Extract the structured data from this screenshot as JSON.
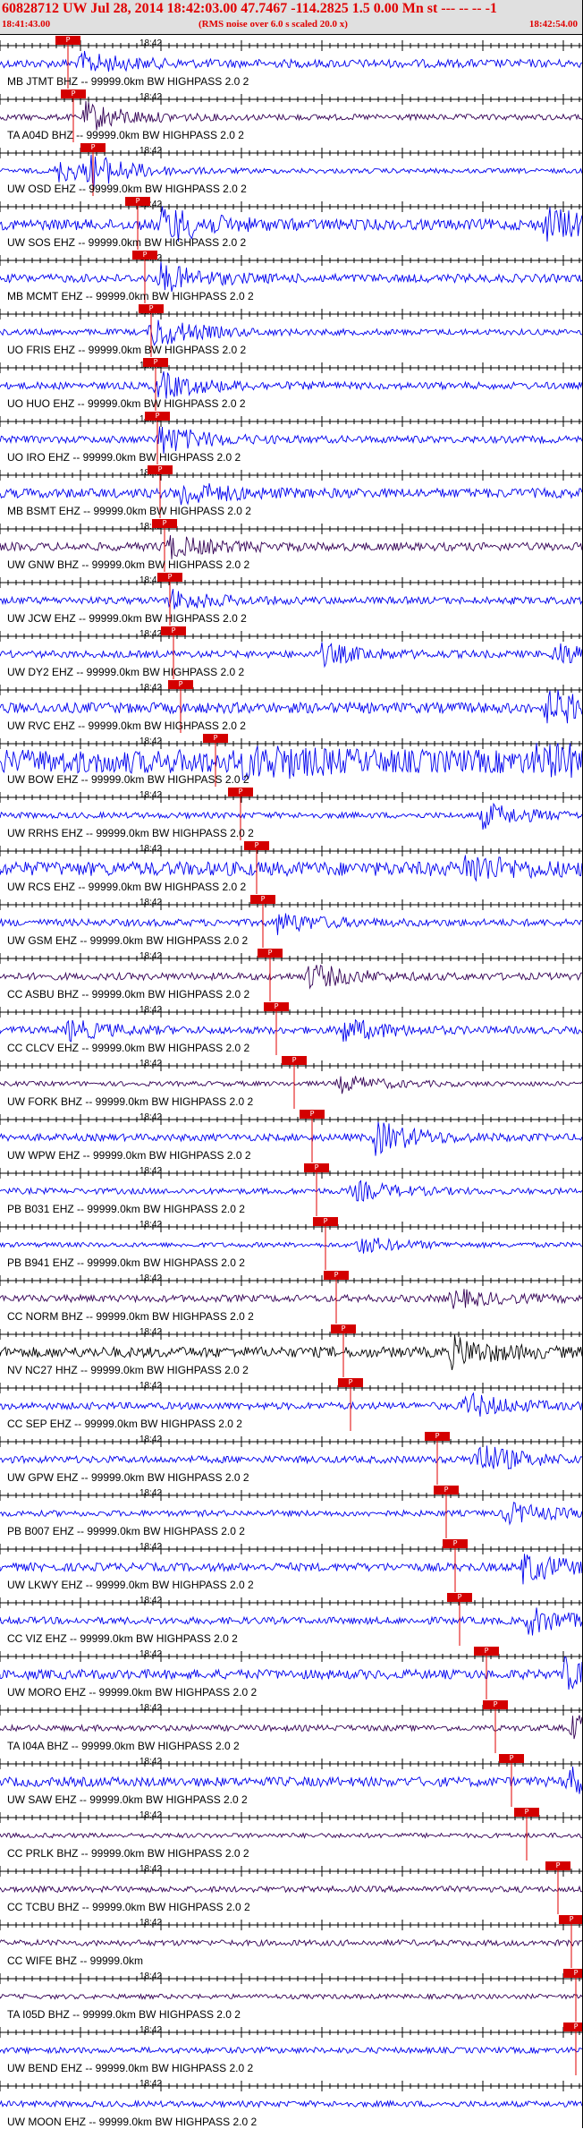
{
  "header": {
    "title": "60828712 UW Jul 28, 2014 18:42:03.00   47.7467 -114.2825  1.5 0.00 Mn st --- -- --  -1",
    "start_time": "18:41:43.00",
    "subtitle": "(RMS noise over 6.0 s scaled 20.0 x)",
    "end_time": "18:42:54.00"
  },
  "minute_label": "18:42",
  "pick_label": "P",
  "colors": {
    "blue": "#0000ee",
    "dark": "#330055",
    "black": "#000000",
    "red": "#e00000"
  },
  "traces": [
    {
      "label": "MB JTMT BHZ -- 99999.0km BW  HIGHPASS  2.0  2",
      "color": "blue",
      "amp": 0.35,
      "bursts": [
        [
          90,
          0.8
        ]
      ]
    },
    {
      "label": "TA A04D BHZ -- 99999.0km BW  HIGHPASS  2.0  2",
      "color": "dark",
      "amp": 0.25,
      "bursts": [
        [
          95,
          1.2
        ]
      ]
    },
    {
      "label": "UW OSD EHZ -- 99999.0km BW  HIGHPASS  2.0  2",
      "color": "blue",
      "amp": 0.2,
      "bursts": [
        [
          65,
          0.9
        ],
        [
          100,
          1.1
        ]
      ]
    },
    {
      "label": "UW SOS EHZ -- 99999.0km BW  HIGHPASS  2.0  2",
      "color": "blue",
      "amp": 0.45,
      "bursts": [
        [
          180,
          1.6
        ],
        [
          610,
          1.4
        ]
      ]
    },
    {
      "label": "MB MCMT EHZ -- 99999.0km BW  HIGHPASS  2.0  2",
      "color": "blue",
      "amp": 0.35,
      "bursts": [
        [
          180,
          1.1
        ]
      ]
    },
    {
      "label": "UO FRIS EHZ -- 99999.0km BW  HIGHPASS  2.0  2",
      "color": "blue",
      "amp": 0.25,
      "bursts": [
        [
          170,
          1.3
        ]
      ]
    },
    {
      "label": "UO HUO EHZ -- 99999.0km BW  HIGHPASS  2.0  2",
      "color": "blue",
      "amp": 0.3,
      "bursts": [
        [
          175,
          1.1
        ]
      ]
    },
    {
      "label": "UO IRO EHZ -- 99999.0km BW  HIGHPASS  2.0  2",
      "color": "blue",
      "amp": 0.3,
      "bursts": [
        [
          178,
          1.2
        ]
      ]
    },
    {
      "label": "MB BSMT EHZ -- 99999.0km BW  HIGHPASS  2.0  2",
      "color": "blue",
      "amp": 0.4,
      "bursts": [
        [
          200,
          1.0
        ]
      ]
    },
    {
      "label": "UW GNW BHZ -- 99999.0km BW  HIGHPASS  2.0  2",
      "color": "dark",
      "amp": 0.35,
      "bursts": [
        [
          185,
          0.9
        ]
      ]
    },
    {
      "label": "UW JCW EHZ -- 99999.0km BW  HIGHPASS  2.0  2",
      "color": "blue",
      "amp": 0.3,
      "bursts": [
        [
          190,
          0.8
        ]
      ]
    },
    {
      "label": "UW DY2 EHZ -- 99999.0km BW  HIGHPASS  2.0  2",
      "color": "blue",
      "amp": 0.3,
      "bursts": [
        [
          360,
          0.8
        ],
        [
          620,
          0.9
        ]
      ]
    },
    {
      "label": "UW RVC EHZ -- 99999.0km BW  HIGHPASS  2.0  2",
      "color": "blue",
      "amp": 0.45,
      "bursts": [
        [
          610,
          1.5
        ]
      ]
    },
    {
      "label": "UW BOW EHZ -- 99999.0km BW  HIGHPASS  2.0  2",
      "color": "blue",
      "amp": 1.0,
      "bursts": [
        [
          270,
          1.6
        ],
        [
          600,
          1.4
        ]
      ]
    },
    {
      "label": "UW RRHS EHZ -- 99999.0km BW  HIGHPASS  2.0  2",
      "color": "blue",
      "amp": 0.25,
      "bursts": [
        [
          540,
          1.0
        ]
      ]
    },
    {
      "label": "UW RCS EHZ -- 99999.0km BW  HIGHPASS  2.0  2",
      "color": "blue",
      "amp": 0.6,
      "bursts": [
        [
          520,
          1.1
        ]
      ]
    },
    {
      "label": "UW GSM EHZ -- 99999.0km BW  HIGHPASS  2.0  2",
      "color": "blue",
      "amp": 0.3,
      "bursts": [
        [
          310,
          0.8
        ]
      ]
    },
    {
      "label": "CC ASBU BHZ -- 99999.0km BW  HIGHPASS  2.0  2",
      "color": "dark",
      "amp": 0.3,
      "bursts": [
        [
          345,
          1.0
        ]
      ]
    },
    {
      "label": "CC CLCV EHZ -- 99999.0km BW  HIGHPASS  2.0  2",
      "color": "blue",
      "amp": 0.3,
      "bursts": [
        [
          75,
          0.8
        ],
        [
          380,
          1.0
        ]
      ]
    },
    {
      "label": "UW FORK BHZ -- 99999.0km BW  HIGHPASS  2.0  2",
      "color": "dark",
      "amp": 0.2,
      "bursts": [
        [
          380,
          0.7
        ]
      ]
    },
    {
      "label": "UW WPW EHZ -- 99999.0km BW  HIGHPASS  2.0  2",
      "color": "blue",
      "amp": 0.3,
      "bursts": [
        [
          420,
          1.3
        ]
      ]
    },
    {
      "label": "PB B031 EHZ -- 99999.0km BW  HIGHPASS  2.0  2",
      "color": "blue",
      "amp": 0.25,
      "bursts": [
        [
          395,
          0.8
        ]
      ]
    },
    {
      "label": "PB B941 EHZ -- 99999.0km BW  HIGHPASS  2.0  2",
      "color": "blue",
      "amp": 0.2,
      "bursts": [
        [
          400,
          0.7
        ]
      ]
    },
    {
      "label": "CC NORM BHZ -- 99999.0km BW  HIGHPASS  2.0  2",
      "color": "dark",
      "amp": 0.3,
      "bursts": [
        [
          505,
          0.7
        ]
      ]
    },
    {
      "label": "NV NC27 HHZ -- 99999.0km BW  HIGHPASS  2.0  2",
      "color": "black",
      "amp": 0.45,
      "bursts": [
        [
          505,
          1.1
        ]
      ]
    },
    {
      "label": "CC SEP EHZ -- 99999.0km BW  HIGHPASS  2.0  2",
      "color": "blue",
      "amp": 0.3,
      "bursts": [
        [
          520,
          1.0
        ]
      ]
    },
    {
      "label": "UW GPW EHZ -- 99999.0km BW  HIGHPASS  2.0  2",
      "color": "blue",
      "amp": 0.3,
      "bursts": [
        [
          530,
          1.4
        ]
      ]
    },
    {
      "label": "PB B007 EHZ -- 99999.0km BW  HIGHPASS  2.0  2",
      "color": "blue",
      "amp": 0.25,
      "bursts": [
        [
          565,
          0.9
        ]
      ]
    },
    {
      "label": "UW LKWY EHZ -- 99999.0km BW  HIGHPASS  2.0  2",
      "color": "blue",
      "amp": 0.35,
      "bursts": [
        [
          585,
          1.2
        ]
      ]
    },
    {
      "label": "CC VIZ EHZ -- 99999.0km BW  HIGHPASS  2.0  2",
      "color": "blue",
      "amp": 0.3,
      "bursts": [
        [
          590,
          1.1
        ]
      ]
    },
    {
      "label": "UW MORO EHZ -- 99999.0km BW  HIGHPASS  2.0  2",
      "color": "blue",
      "amp": 0.4,
      "bursts": [
        [
          630,
          1.2
        ]
      ]
    },
    {
      "label": "TA I04A BHZ -- 99999.0km BW  HIGHPASS  2.0  2",
      "color": "dark",
      "amp": 0.25,
      "bursts": [
        [
          640,
          1.1
        ]
      ]
    },
    {
      "label": "UW SAW EHZ -- 99999.0km BW  HIGHPASS  2.0  2",
      "color": "blue",
      "amp": 0.4,
      "bursts": [
        [
          635,
          1.1
        ]
      ]
    },
    {
      "label": "CC PRLK BHZ -- 99999.0km BW  HIGHPASS  2.0  2",
      "color": "dark",
      "amp": 0.2,
      "bursts": []
    },
    {
      "label": "CC TCBU BHZ -- 99999.0km BW  HIGHPASS  2.0  2",
      "color": "dark",
      "amp": 0.25,
      "bursts": []
    },
    {
      "label": "CC WIFE BHZ -- 99999.0km",
      "color": "dark",
      "amp": 0.25,
      "bursts": []
    },
    {
      "label": "TA I05D BHZ -- 99999.0km BW  HIGHPASS  2.0  2",
      "color": "dark",
      "amp": 0.2,
      "bursts": []
    },
    {
      "label": "UW BEND EHZ -- 99999.0km BW  HIGHPASS  2.0  2",
      "color": "blue",
      "amp": 0.25,
      "bursts": []
    },
    {
      "label": "UW MOON EHZ -- 99999.0km BW  HIGHPASS  2.0  2",
      "color": "blue",
      "amp": 0.25,
      "bursts": []
    }
  ],
  "picks": [
    72,
    78,
    100,
    150,
    158,
    165,
    170,
    172,
    175,
    180,
    186,
    190,
    198,
    237,
    265,
    283,
    290,
    298,
    305,
    325,
    345,
    350,
    360,
    372,
    380,
    388,
    485,
    495,
    505,
    510,
    540,
    550,
    568,
    585,
    620,
    635,
    640,
    640
  ]
}
